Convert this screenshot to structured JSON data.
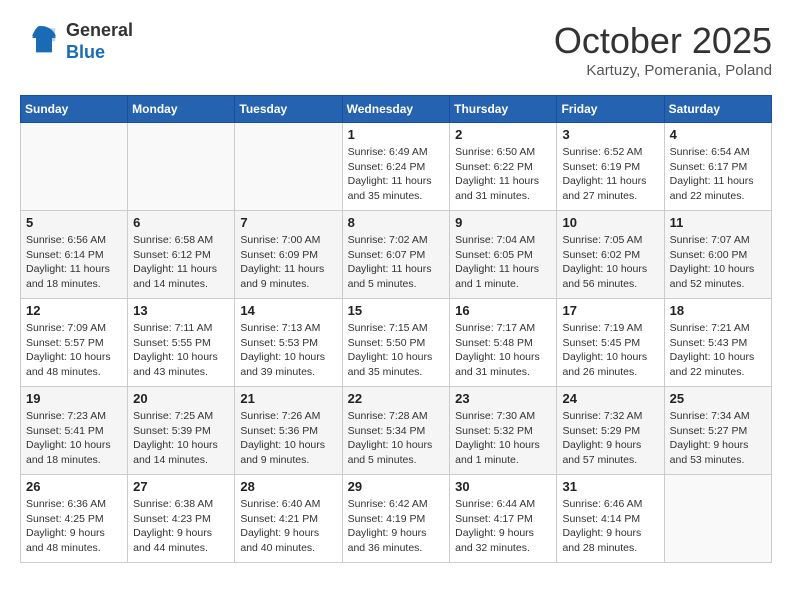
{
  "header": {
    "logo": {
      "line1": "General",
      "line2": "Blue"
    },
    "title": "October 2025",
    "subtitle": "Kartuzy, Pomerania, Poland"
  },
  "calendar": {
    "days_of_week": [
      "Sunday",
      "Monday",
      "Tuesday",
      "Wednesday",
      "Thursday",
      "Friday",
      "Saturday"
    ],
    "weeks": [
      [
        {
          "day": "",
          "info": ""
        },
        {
          "day": "",
          "info": ""
        },
        {
          "day": "",
          "info": ""
        },
        {
          "day": "1",
          "info": "Sunrise: 6:49 AM\nSunset: 6:24 PM\nDaylight: 11 hours\nand 35 minutes."
        },
        {
          "day": "2",
          "info": "Sunrise: 6:50 AM\nSunset: 6:22 PM\nDaylight: 11 hours\nand 31 minutes."
        },
        {
          "day": "3",
          "info": "Sunrise: 6:52 AM\nSunset: 6:19 PM\nDaylight: 11 hours\nand 27 minutes."
        },
        {
          "day": "4",
          "info": "Sunrise: 6:54 AM\nSunset: 6:17 PM\nDaylight: 11 hours\nand 22 minutes."
        }
      ],
      [
        {
          "day": "5",
          "info": "Sunrise: 6:56 AM\nSunset: 6:14 PM\nDaylight: 11 hours\nand 18 minutes."
        },
        {
          "day": "6",
          "info": "Sunrise: 6:58 AM\nSunset: 6:12 PM\nDaylight: 11 hours\nand 14 minutes."
        },
        {
          "day": "7",
          "info": "Sunrise: 7:00 AM\nSunset: 6:09 PM\nDaylight: 11 hours\nand 9 minutes."
        },
        {
          "day": "8",
          "info": "Sunrise: 7:02 AM\nSunset: 6:07 PM\nDaylight: 11 hours\nand 5 minutes."
        },
        {
          "day": "9",
          "info": "Sunrise: 7:04 AM\nSunset: 6:05 PM\nDaylight: 11 hours\nand 1 minute."
        },
        {
          "day": "10",
          "info": "Sunrise: 7:05 AM\nSunset: 6:02 PM\nDaylight: 10 hours\nand 56 minutes."
        },
        {
          "day": "11",
          "info": "Sunrise: 7:07 AM\nSunset: 6:00 PM\nDaylight: 10 hours\nand 52 minutes."
        }
      ],
      [
        {
          "day": "12",
          "info": "Sunrise: 7:09 AM\nSunset: 5:57 PM\nDaylight: 10 hours\nand 48 minutes."
        },
        {
          "day": "13",
          "info": "Sunrise: 7:11 AM\nSunset: 5:55 PM\nDaylight: 10 hours\nand 43 minutes."
        },
        {
          "day": "14",
          "info": "Sunrise: 7:13 AM\nSunset: 5:53 PM\nDaylight: 10 hours\nand 39 minutes."
        },
        {
          "day": "15",
          "info": "Sunrise: 7:15 AM\nSunset: 5:50 PM\nDaylight: 10 hours\nand 35 minutes."
        },
        {
          "day": "16",
          "info": "Sunrise: 7:17 AM\nSunset: 5:48 PM\nDaylight: 10 hours\nand 31 minutes."
        },
        {
          "day": "17",
          "info": "Sunrise: 7:19 AM\nSunset: 5:45 PM\nDaylight: 10 hours\nand 26 minutes."
        },
        {
          "day": "18",
          "info": "Sunrise: 7:21 AM\nSunset: 5:43 PM\nDaylight: 10 hours\nand 22 minutes."
        }
      ],
      [
        {
          "day": "19",
          "info": "Sunrise: 7:23 AM\nSunset: 5:41 PM\nDaylight: 10 hours\nand 18 minutes."
        },
        {
          "day": "20",
          "info": "Sunrise: 7:25 AM\nSunset: 5:39 PM\nDaylight: 10 hours\nand 14 minutes."
        },
        {
          "day": "21",
          "info": "Sunrise: 7:26 AM\nSunset: 5:36 PM\nDaylight: 10 hours\nand 9 minutes."
        },
        {
          "day": "22",
          "info": "Sunrise: 7:28 AM\nSunset: 5:34 PM\nDaylight: 10 hours\nand 5 minutes."
        },
        {
          "day": "23",
          "info": "Sunrise: 7:30 AM\nSunset: 5:32 PM\nDaylight: 10 hours\nand 1 minute."
        },
        {
          "day": "24",
          "info": "Sunrise: 7:32 AM\nSunset: 5:29 PM\nDaylight: 9 hours\nand 57 minutes."
        },
        {
          "day": "25",
          "info": "Sunrise: 7:34 AM\nSunset: 5:27 PM\nDaylight: 9 hours\nand 53 minutes."
        }
      ],
      [
        {
          "day": "26",
          "info": "Sunrise: 6:36 AM\nSunset: 4:25 PM\nDaylight: 9 hours\nand 48 minutes."
        },
        {
          "day": "27",
          "info": "Sunrise: 6:38 AM\nSunset: 4:23 PM\nDaylight: 9 hours\nand 44 minutes."
        },
        {
          "day": "28",
          "info": "Sunrise: 6:40 AM\nSunset: 4:21 PM\nDaylight: 9 hours\nand 40 minutes."
        },
        {
          "day": "29",
          "info": "Sunrise: 6:42 AM\nSunset: 4:19 PM\nDaylight: 9 hours\nand 36 minutes."
        },
        {
          "day": "30",
          "info": "Sunrise: 6:44 AM\nSunset: 4:17 PM\nDaylight: 9 hours\nand 32 minutes."
        },
        {
          "day": "31",
          "info": "Sunrise: 6:46 AM\nSunset: 4:14 PM\nDaylight: 9 hours\nand 28 minutes."
        },
        {
          "day": "",
          "info": ""
        }
      ]
    ]
  }
}
